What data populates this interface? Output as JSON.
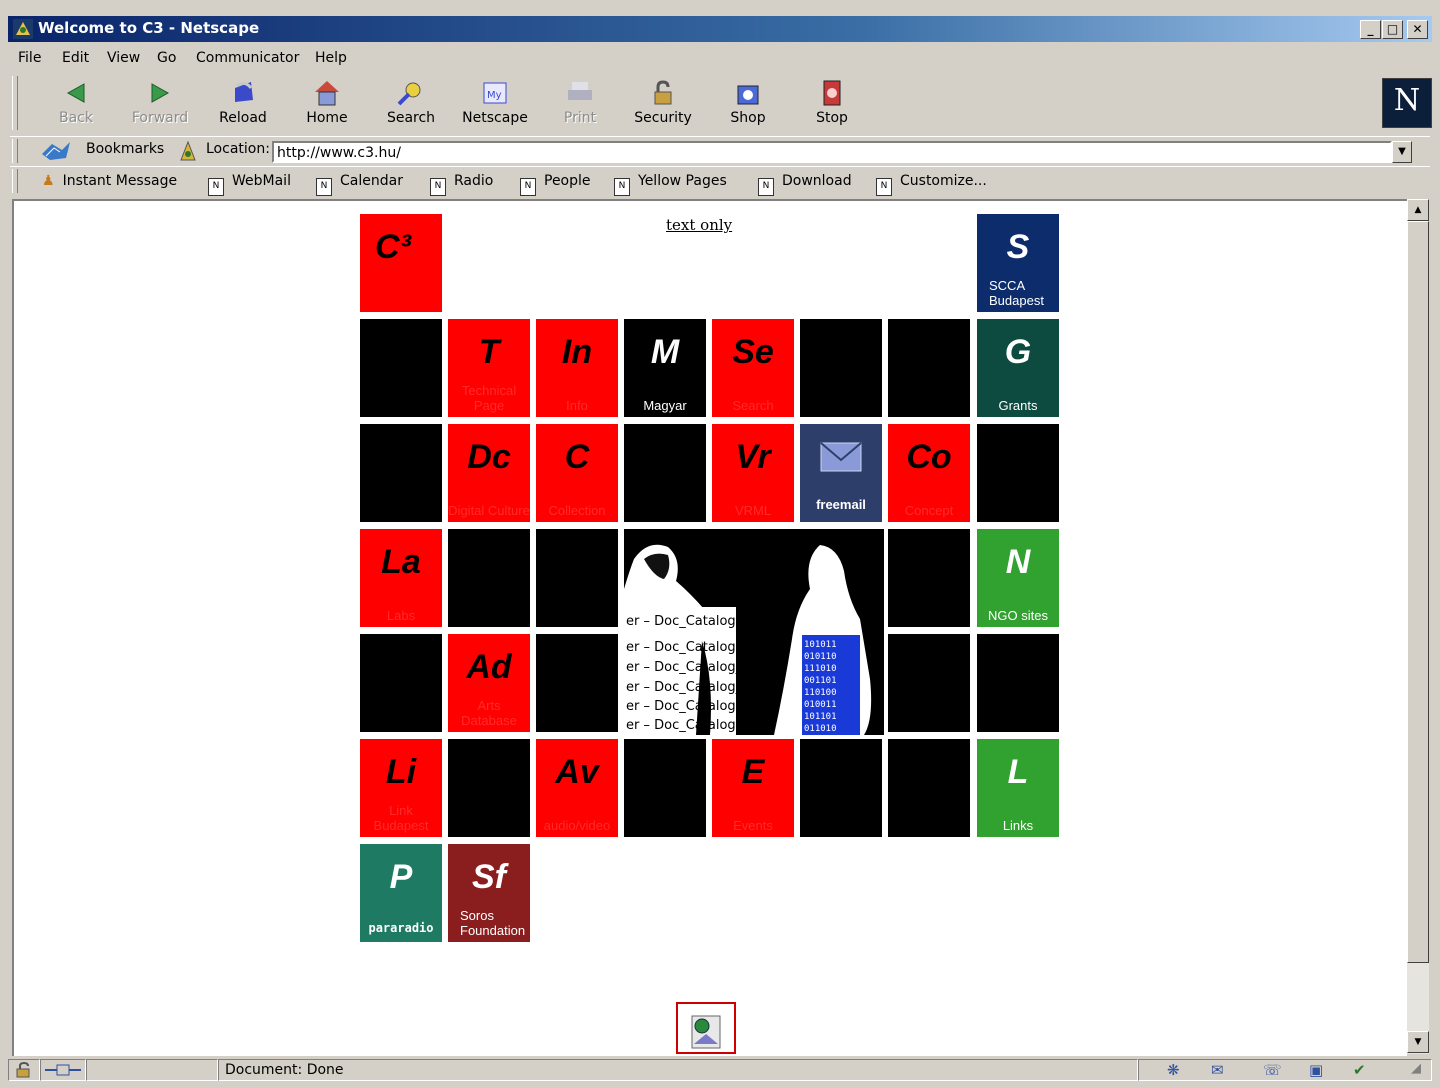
{
  "window": {
    "title": "Welcome to C3 - Netscape"
  },
  "menu": [
    "File",
    "Edit",
    "View",
    "Go",
    "Communicator",
    "Help"
  ],
  "toolbar": [
    {
      "label": "Back",
      "icon": "back-arrow-icon",
      "enabled": false
    },
    {
      "label": "Forward",
      "icon": "forward-arrow-icon",
      "enabled": false
    },
    {
      "label": "Reload",
      "icon": "reload-icon",
      "enabled": true
    },
    {
      "label": "Home",
      "icon": "home-icon",
      "enabled": true
    },
    {
      "label": "Search",
      "icon": "search-icon",
      "enabled": true
    },
    {
      "label": "Netscape",
      "icon": "my-netscape-icon",
      "enabled": true
    },
    {
      "label": "Print",
      "icon": "printer-icon",
      "enabled": false
    },
    {
      "label": "Security",
      "icon": "padlock-icon",
      "enabled": true
    },
    {
      "label": "Shop",
      "icon": "shop-icon",
      "enabled": true
    },
    {
      "label": "Stop",
      "icon": "stop-icon",
      "enabled": true
    }
  ],
  "location": {
    "bookmarks_label": "Bookmarks",
    "label": "Location:",
    "url": "http://www.c3.hu/"
  },
  "personal_bar": [
    "Instant Message",
    "WebMail",
    "Calendar",
    "Radio",
    "People",
    "Yellow Pages",
    "Download",
    "Customize..."
  ],
  "page": {
    "text_only_link": "text only",
    "tiles": [
      {
        "sym": "C³",
        "name": "",
        "style": "red"
      },
      {
        "sym": "S",
        "name": "SCCA Budapest",
        "style": "navy"
      },
      {
        "sym": "",
        "name": "",
        "style": "black"
      },
      {
        "sym": "T",
        "name": "Technical Page",
        "style": "red"
      },
      {
        "sym": "In",
        "name": "Info",
        "style": "red"
      },
      {
        "sym": "M",
        "name": "Magyar",
        "style": "black"
      },
      {
        "sym": "Se",
        "name": "Search",
        "style": "red"
      },
      {
        "sym": "",
        "name": "",
        "style": "black"
      },
      {
        "sym": "",
        "name": "",
        "style": "black"
      },
      {
        "sym": "G",
        "name": "Grants",
        "style": "dgreen"
      },
      {
        "sym": "",
        "name": "",
        "style": "black"
      },
      {
        "sym": "Dc",
        "name": "Digital Culture",
        "style": "red"
      },
      {
        "sym": "C",
        "name": "Collection",
        "style": "red"
      },
      {
        "sym": "",
        "name": "",
        "style": "black"
      },
      {
        "sym": "Vr",
        "name": "VRML",
        "style": "red"
      },
      {
        "sym": "",
        "name": "freemail",
        "style": "slate"
      },
      {
        "sym": "Co",
        "name": "Concept",
        "style": "red"
      },
      {
        "sym": "",
        "name": "",
        "style": "black"
      },
      {
        "sym": "La",
        "name": "Labs",
        "style": "red"
      },
      {
        "sym": "",
        "name": "",
        "style": "black"
      },
      {
        "sym": "",
        "name": "",
        "style": "black"
      },
      {
        "sym": "",
        "name": "",
        "style": "black"
      },
      {
        "sym": "N",
        "name": "NGO sites",
        "style": "lgreen"
      },
      {
        "sym": "",
        "name": "",
        "style": "black"
      },
      {
        "sym": "Ad",
        "name": "Arts Database",
        "style": "red"
      },
      {
        "sym": "",
        "name": "",
        "style": "black"
      },
      {
        "sym": "",
        "name": "",
        "style": "black"
      },
      {
        "sym": "",
        "name": "",
        "style": "black"
      },
      {
        "sym": "Li",
        "name": "Link Budapest",
        "style": "red"
      },
      {
        "sym": "",
        "name": "",
        "style": "black"
      },
      {
        "sym": "Av",
        "name": "audio/video",
        "style": "red"
      },
      {
        "sym": "",
        "name": "",
        "style": "black"
      },
      {
        "sym": "E",
        "name": "Events",
        "style": "red"
      },
      {
        "sym": "",
        "name": "",
        "style": "black"
      },
      {
        "sym": "",
        "name": "",
        "style": "black"
      },
      {
        "sym": "L",
        "name": "Links",
        "style": "lgreen"
      },
      {
        "sym": "P",
        "name": "pararadio",
        "style": "teal"
      },
      {
        "sym": "Sf",
        "name": "Soros Foundation",
        "style": "maroon"
      }
    ],
    "photo_text": [
      "er – Doc_Catalog",
      "er – Doc_Catalog",
      "er – Doc_Catalog_",
      "er – Doc_Catalog_",
      "er – Doc_Catalog",
      "er – Doc_Catalog"
    ]
  },
  "status": {
    "text": "Document: Done"
  }
}
